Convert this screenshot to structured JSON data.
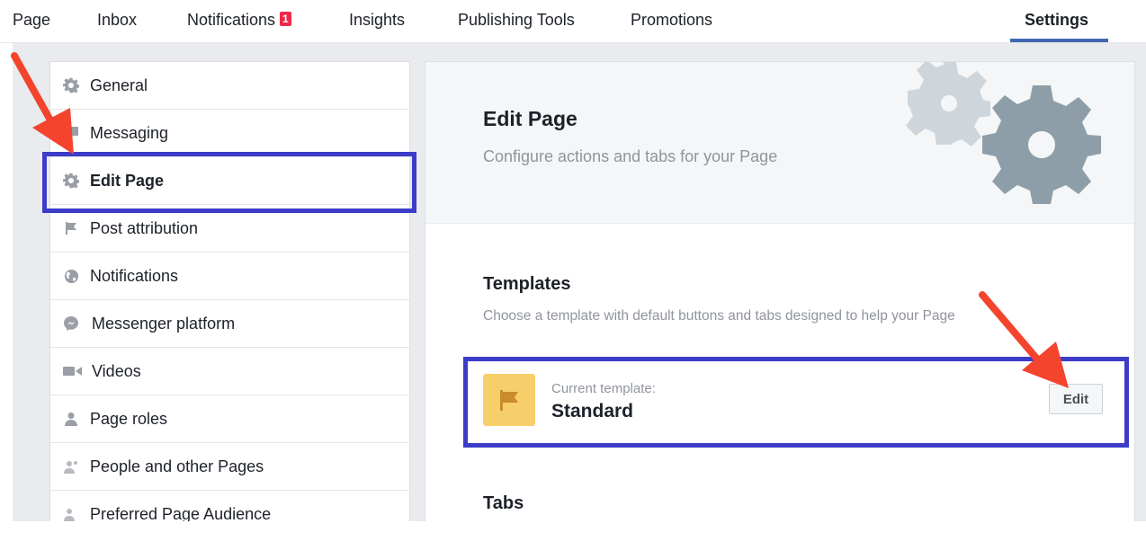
{
  "topnav": {
    "items": [
      {
        "label": "Page"
      },
      {
        "label": "Inbox"
      },
      {
        "label": "Notifications",
        "badge": "1"
      },
      {
        "label": "Insights"
      },
      {
        "label": "Publishing Tools"
      },
      {
        "label": "Promotions"
      },
      {
        "label": "Settings",
        "active": true
      }
    ]
  },
  "sidebar": {
    "items": [
      {
        "label": "General",
        "icon": "gear-icon"
      },
      {
        "label": "Messaging",
        "icon": "chat-icon"
      },
      {
        "label": "Edit Page",
        "icon": "gear-icon",
        "active": true
      },
      {
        "label": "Post attribution",
        "icon": "flag-icon"
      },
      {
        "label": "Notifications",
        "icon": "globe-icon"
      },
      {
        "label": "Messenger platform",
        "icon": "messenger-icon"
      },
      {
        "label": "Videos",
        "icon": "video-camera-icon"
      },
      {
        "label": "Page roles",
        "icon": "person-icon"
      },
      {
        "label": "People and other Pages",
        "icon": "people-icon"
      },
      {
        "label": "Preferred Page Audience",
        "icon": "people-icon"
      }
    ]
  },
  "main": {
    "title": "Edit Page",
    "subtitle": "Configure actions and tabs for your Page",
    "templates": {
      "heading": "Templates",
      "description": "Choose a template with default buttons and tabs designed to help your Page",
      "current_caption": "Current template:",
      "current_name": "Standard",
      "edit_label": "Edit"
    },
    "tabs_heading": "Tabs"
  },
  "colors": {
    "accent": "#4267b2",
    "highlight_box": "#3c3cc8",
    "arrow": "#f4442e",
    "template_icon_bg": "#f7cf6a",
    "gear_light": "#ced6dc",
    "gear_dark": "#8d9ea8"
  }
}
